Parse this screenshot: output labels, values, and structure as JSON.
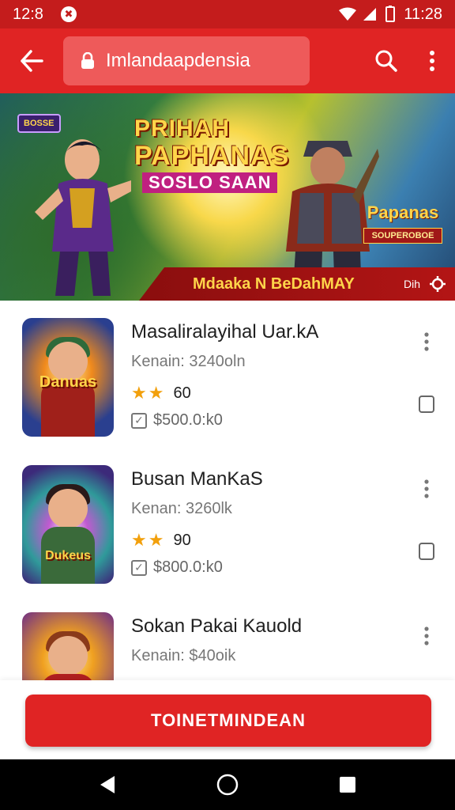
{
  "status_bar": {
    "left_time": "12:8",
    "right_time": "11:28"
  },
  "app_bar": {
    "search_text": "Imlandaapdensia"
  },
  "banner": {
    "badge": "BOSSE",
    "title_line1": "PRIHAH",
    "title_line2": "PAPHANAS",
    "title_line3": "SOSLO SAAN",
    "right_title": "Papanas",
    "right_sub": "SOUPEROBOE",
    "strip_text": "Mdaaka N BeDahMAY",
    "strip_tail": "Dih"
  },
  "items": [
    {
      "title": "Masaliralayihal Uar.kA",
      "subtitle": "Kenain: 3240oln",
      "stars": "★★",
      "rating": "60",
      "price": "$500.0:k0",
      "thumb_label": "Danuas",
      "thumb_colors": [
        "#2a3f8f",
        "#f08a1c"
      ]
    },
    {
      "title": "Busan ManKaS",
      "subtitle": "Kenan: 3260lk",
      "stars": "★★",
      "rating": "90",
      "price": "$800.0:k0",
      "thumb_label": "Dukeus",
      "thumb_colors": [
        "#3c2a7a",
        "#2f9a9a"
      ]
    },
    {
      "title": "Sokan Pakai Kauold",
      "subtitle": "Kenain: $40oik",
      "stars": "",
      "rating": "",
      "price": "",
      "thumb_label": "",
      "thumb_colors": [
        "#6a2a8a",
        "#f0a020"
      ]
    }
  ],
  "cta": {
    "label": "TOINETMINDEAN"
  },
  "colors": {
    "primary_red": "#e02424",
    "status_red": "#c41c1c",
    "star": "#f2a00c"
  }
}
